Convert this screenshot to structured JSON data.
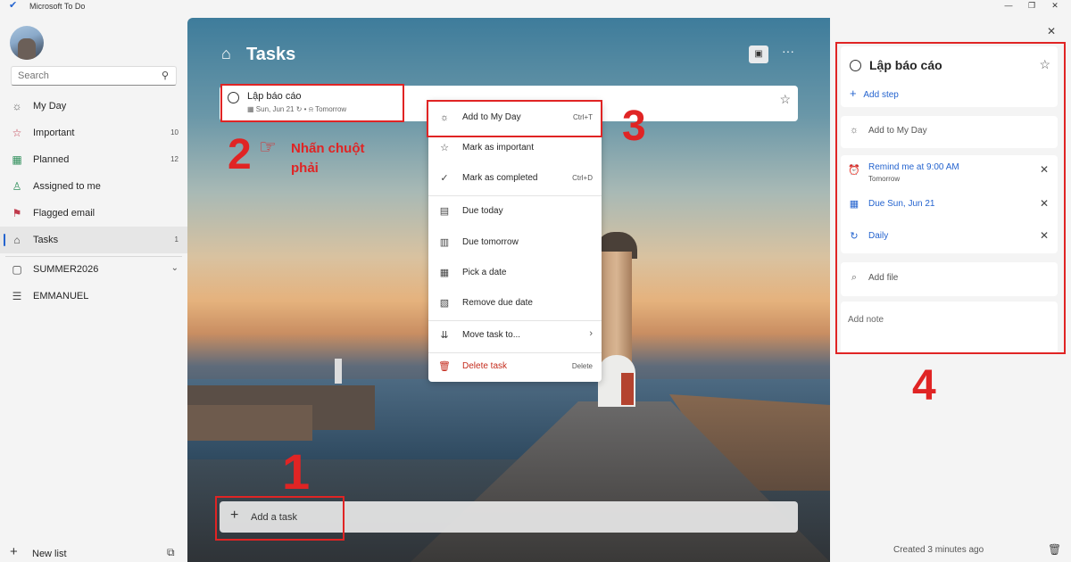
{
  "app": {
    "title": "Microsoft To Do",
    "logo_icon": "checkmark-icon"
  },
  "window": {
    "minimize": "—",
    "restore": "❐",
    "close": "✕"
  },
  "sidebar": {
    "search_placeholder": "Search",
    "items": [
      {
        "label": "My Day",
        "icon": "sun-icon",
        "count": ""
      },
      {
        "label": "Important",
        "icon": "star-icon",
        "count": "10"
      },
      {
        "label": "Planned",
        "icon": "calendar-grid-icon",
        "count": "12"
      },
      {
        "label": "Assigned to me",
        "icon": "person-icon",
        "count": ""
      },
      {
        "label": "Flagged email",
        "icon": "flag-icon",
        "count": ""
      },
      {
        "label": "Tasks",
        "icon": "home-icon",
        "count": "1"
      }
    ],
    "groups": [
      {
        "label": "SUMMER2026",
        "icon": "group-icon"
      },
      {
        "label": "EMMANUEL",
        "icon": "list-icon"
      }
    ],
    "new_list_label": "New list"
  },
  "main": {
    "list_title": "Tasks",
    "task": {
      "title": "Lập báo cáo",
      "due": "Sun, Jun 21",
      "reminder": "Tomorrow"
    },
    "add_task_label": "Add a task"
  },
  "annotations": {
    "step1": "1",
    "step2": "2",
    "step2_text_line1": "Nhấn chuột",
    "step2_text_line2": "phải",
    "step3": "3",
    "step4": "4",
    "color": "#e02424"
  },
  "context_menu": {
    "items": [
      {
        "label": "Add to My Day",
        "shortcut": "Ctrl+T",
        "icon": "sun-icon"
      },
      {
        "label": "Mark as important",
        "shortcut": "",
        "icon": "star-icon"
      },
      {
        "label": "Mark as completed",
        "shortcut": "Ctrl+D",
        "icon": "check-circle-icon"
      },
      {
        "label": "Due today",
        "shortcut": "",
        "icon": "calendar-today-icon"
      },
      {
        "label": "Due tomorrow",
        "shortcut": "",
        "icon": "calendar-tomorrow-icon"
      },
      {
        "label": "Pick a date",
        "shortcut": "",
        "icon": "calendar-pick-icon"
      },
      {
        "label": "Remove due date",
        "shortcut": "",
        "icon": "calendar-remove-icon"
      },
      {
        "label": "Move task to...",
        "shortcut": "",
        "icon": "move-icon"
      },
      {
        "label": "Delete task",
        "shortcut": "Delete",
        "icon": "trash-icon"
      }
    ]
  },
  "detail": {
    "title": "Lập báo cáo",
    "add_step": "Add step",
    "add_to_my_day": "Add to My Day",
    "remind": "Remind me at 9:00 AM",
    "remind_sub": "Tomorrow",
    "due": "Due Sun, Jun 21",
    "repeat": "Daily",
    "add_file": "Add file",
    "add_note": "Add note",
    "created": "Created 3 minutes ago"
  },
  "colors": {
    "accent": "#2564cf",
    "annotation": "#e02424",
    "delete": "#c42b1c"
  }
}
